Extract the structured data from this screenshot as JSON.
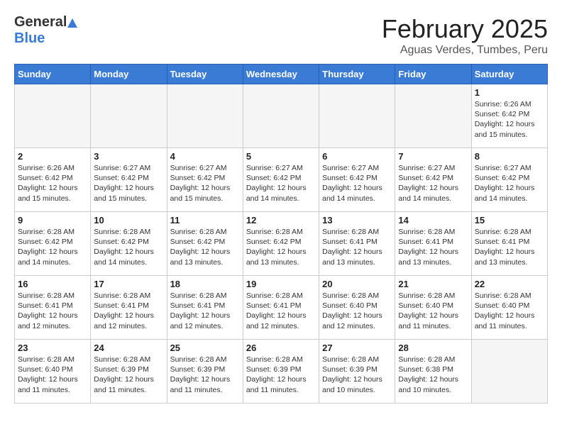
{
  "header": {
    "logo_general": "General",
    "logo_blue": "Blue",
    "month_title": "February 2025",
    "location": "Aguas Verdes, Tumbes, Peru"
  },
  "weekdays": [
    "Sunday",
    "Monday",
    "Tuesday",
    "Wednesday",
    "Thursday",
    "Friday",
    "Saturday"
  ],
  "weeks": [
    [
      {
        "day": "",
        "info": ""
      },
      {
        "day": "",
        "info": ""
      },
      {
        "day": "",
        "info": ""
      },
      {
        "day": "",
        "info": ""
      },
      {
        "day": "",
        "info": ""
      },
      {
        "day": "",
        "info": ""
      },
      {
        "day": "1",
        "info": "Sunrise: 6:26 AM\nSunset: 6:42 PM\nDaylight: 12 hours\nand 15 minutes."
      }
    ],
    [
      {
        "day": "2",
        "info": "Sunrise: 6:26 AM\nSunset: 6:42 PM\nDaylight: 12 hours\nand 15 minutes."
      },
      {
        "day": "3",
        "info": "Sunrise: 6:27 AM\nSunset: 6:42 PM\nDaylight: 12 hours\nand 15 minutes."
      },
      {
        "day": "4",
        "info": "Sunrise: 6:27 AM\nSunset: 6:42 PM\nDaylight: 12 hours\nand 15 minutes."
      },
      {
        "day": "5",
        "info": "Sunrise: 6:27 AM\nSunset: 6:42 PM\nDaylight: 12 hours\nand 14 minutes."
      },
      {
        "day": "6",
        "info": "Sunrise: 6:27 AM\nSunset: 6:42 PM\nDaylight: 12 hours\nand 14 minutes."
      },
      {
        "day": "7",
        "info": "Sunrise: 6:27 AM\nSunset: 6:42 PM\nDaylight: 12 hours\nand 14 minutes."
      },
      {
        "day": "8",
        "info": "Sunrise: 6:27 AM\nSunset: 6:42 PM\nDaylight: 12 hours\nand 14 minutes."
      }
    ],
    [
      {
        "day": "9",
        "info": "Sunrise: 6:28 AM\nSunset: 6:42 PM\nDaylight: 12 hours\nand 14 minutes."
      },
      {
        "day": "10",
        "info": "Sunrise: 6:28 AM\nSunset: 6:42 PM\nDaylight: 12 hours\nand 14 minutes."
      },
      {
        "day": "11",
        "info": "Sunrise: 6:28 AM\nSunset: 6:42 PM\nDaylight: 12 hours\nand 13 minutes."
      },
      {
        "day": "12",
        "info": "Sunrise: 6:28 AM\nSunset: 6:42 PM\nDaylight: 12 hours\nand 13 minutes."
      },
      {
        "day": "13",
        "info": "Sunrise: 6:28 AM\nSunset: 6:41 PM\nDaylight: 12 hours\nand 13 minutes."
      },
      {
        "day": "14",
        "info": "Sunrise: 6:28 AM\nSunset: 6:41 PM\nDaylight: 12 hours\nand 13 minutes."
      },
      {
        "day": "15",
        "info": "Sunrise: 6:28 AM\nSunset: 6:41 PM\nDaylight: 12 hours\nand 13 minutes."
      }
    ],
    [
      {
        "day": "16",
        "info": "Sunrise: 6:28 AM\nSunset: 6:41 PM\nDaylight: 12 hours\nand 12 minutes."
      },
      {
        "day": "17",
        "info": "Sunrise: 6:28 AM\nSunset: 6:41 PM\nDaylight: 12 hours\nand 12 minutes."
      },
      {
        "day": "18",
        "info": "Sunrise: 6:28 AM\nSunset: 6:41 PM\nDaylight: 12 hours\nand 12 minutes."
      },
      {
        "day": "19",
        "info": "Sunrise: 6:28 AM\nSunset: 6:41 PM\nDaylight: 12 hours\nand 12 minutes."
      },
      {
        "day": "20",
        "info": "Sunrise: 6:28 AM\nSunset: 6:40 PM\nDaylight: 12 hours\nand 12 minutes."
      },
      {
        "day": "21",
        "info": "Sunrise: 6:28 AM\nSunset: 6:40 PM\nDaylight: 12 hours\nand 11 minutes."
      },
      {
        "day": "22",
        "info": "Sunrise: 6:28 AM\nSunset: 6:40 PM\nDaylight: 12 hours\nand 11 minutes."
      }
    ],
    [
      {
        "day": "23",
        "info": "Sunrise: 6:28 AM\nSunset: 6:40 PM\nDaylight: 12 hours\nand 11 minutes."
      },
      {
        "day": "24",
        "info": "Sunrise: 6:28 AM\nSunset: 6:39 PM\nDaylight: 12 hours\nand 11 minutes."
      },
      {
        "day": "25",
        "info": "Sunrise: 6:28 AM\nSunset: 6:39 PM\nDaylight: 12 hours\nand 11 minutes."
      },
      {
        "day": "26",
        "info": "Sunrise: 6:28 AM\nSunset: 6:39 PM\nDaylight: 12 hours\nand 11 minutes."
      },
      {
        "day": "27",
        "info": "Sunrise: 6:28 AM\nSunset: 6:39 PM\nDaylight: 12 hours\nand 10 minutes."
      },
      {
        "day": "28",
        "info": "Sunrise: 6:28 AM\nSunset: 6:38 PM\nDaylight: 12 hours\nand 10 minutes."
      },
      {
        "day": "",
        "info": ""
      }
    ]
  ]
}
